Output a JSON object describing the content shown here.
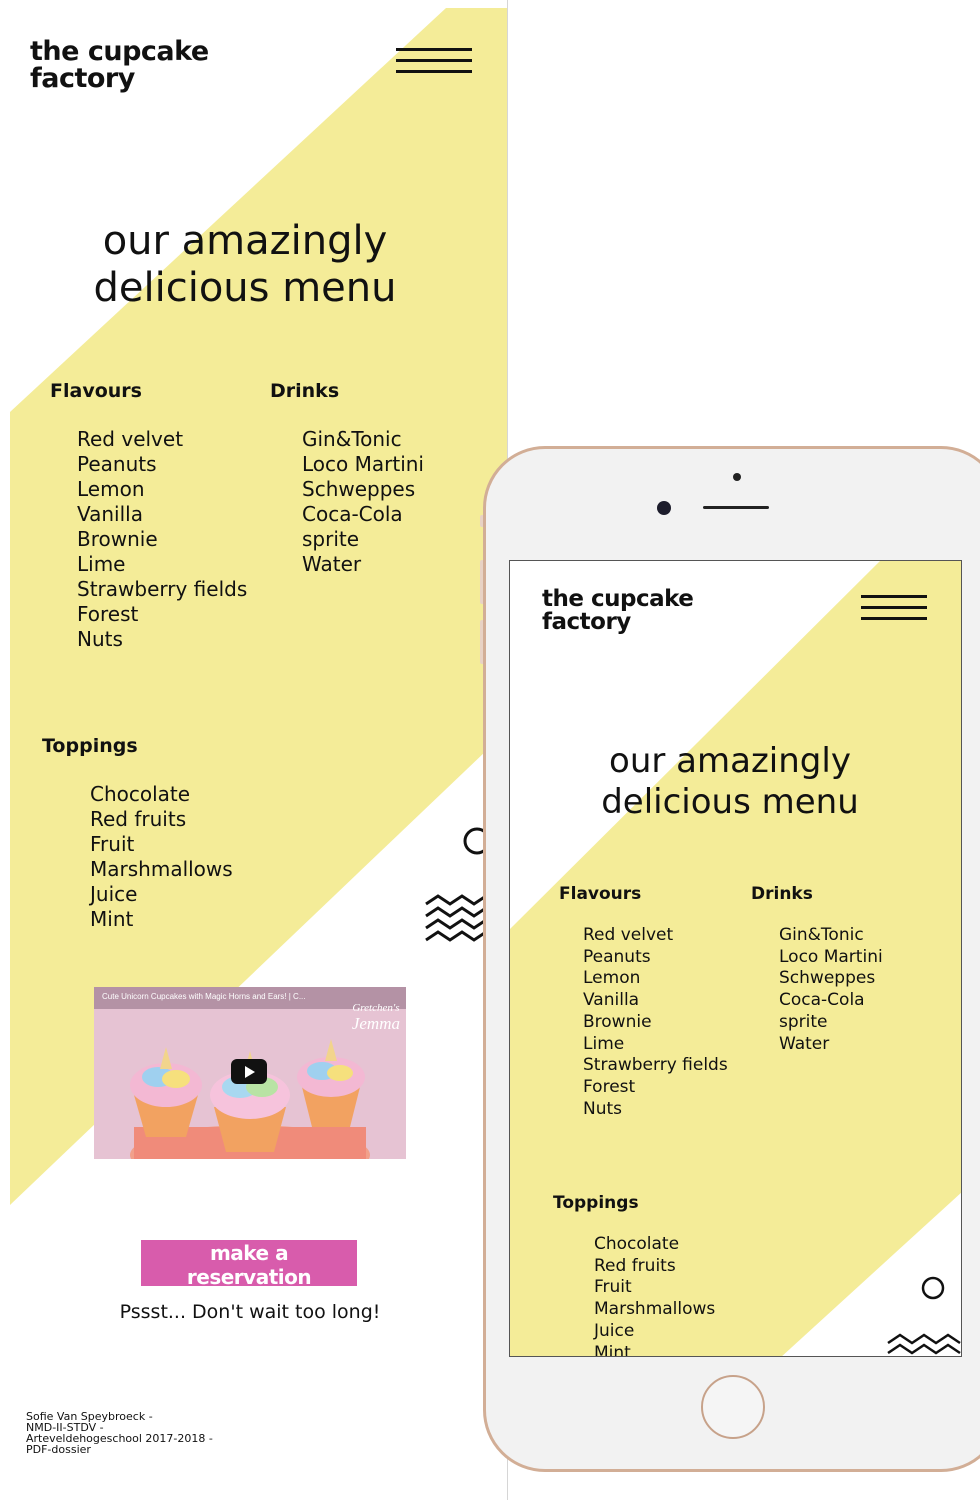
{
  "brand": {
    "line1": "the cupcake",
    "line2": "factory"
  },
  "hero": {
    "line1": "our amazingly",
    "line2": "delicious menu"
  },
  "menu": {
    "flavours_title": "Flavours",
    "flavours": [
      "Red velvet",
      "Peanuts",
      "Lemon",
      "Vanilla",
      "Brownie",
      "Lime",
      "Strawberry fields",
      "Forest",
      "Nuts"
    ],
    "drinks_title": "Drinks",
    "drinks": [
      "Gin&Tonic",
      "Loco Martini",
      "Schweppes",
      "Coca-Cola",
      "sprite",
      "Water"
    ],
    "toppings_title": "Toppings",
    "toppings": [
      "Chocolate",
      "Red fruits",
      "Fruit",
      "Marshmallows",
      "Juice",
      "Mint"
    ]
  },
  "video": {
    "title": "Cute Unicorn Cupcakes with Magic Horns and Ears! | C...",
    "channel_line1": "Gretchen's",
    "channel_line2": "Jemma"
  },
  "reservation": {
    "button_label": "make a reservation",
    "note": "Pssst... Don't wait too long!"
  },
  "credits": {
    "line1": "Sofie Van Speybroeck -",
    "line2": "NMD-II-STDV -",
    "line3": "Arteveldehogeschool 2017-2018 -",
    "line4": "PDF-dossier"
  },
  "colors": {
    "yellow": "#f4ec98",
    "button": "#d85cac",
    "phone_frame": "#d2ae96"
  },
  "icons": [
    "hamburger-menu-icon",
    "circle-icon",
    "zigzag-icon",
    "play-icon"
  ]
}
